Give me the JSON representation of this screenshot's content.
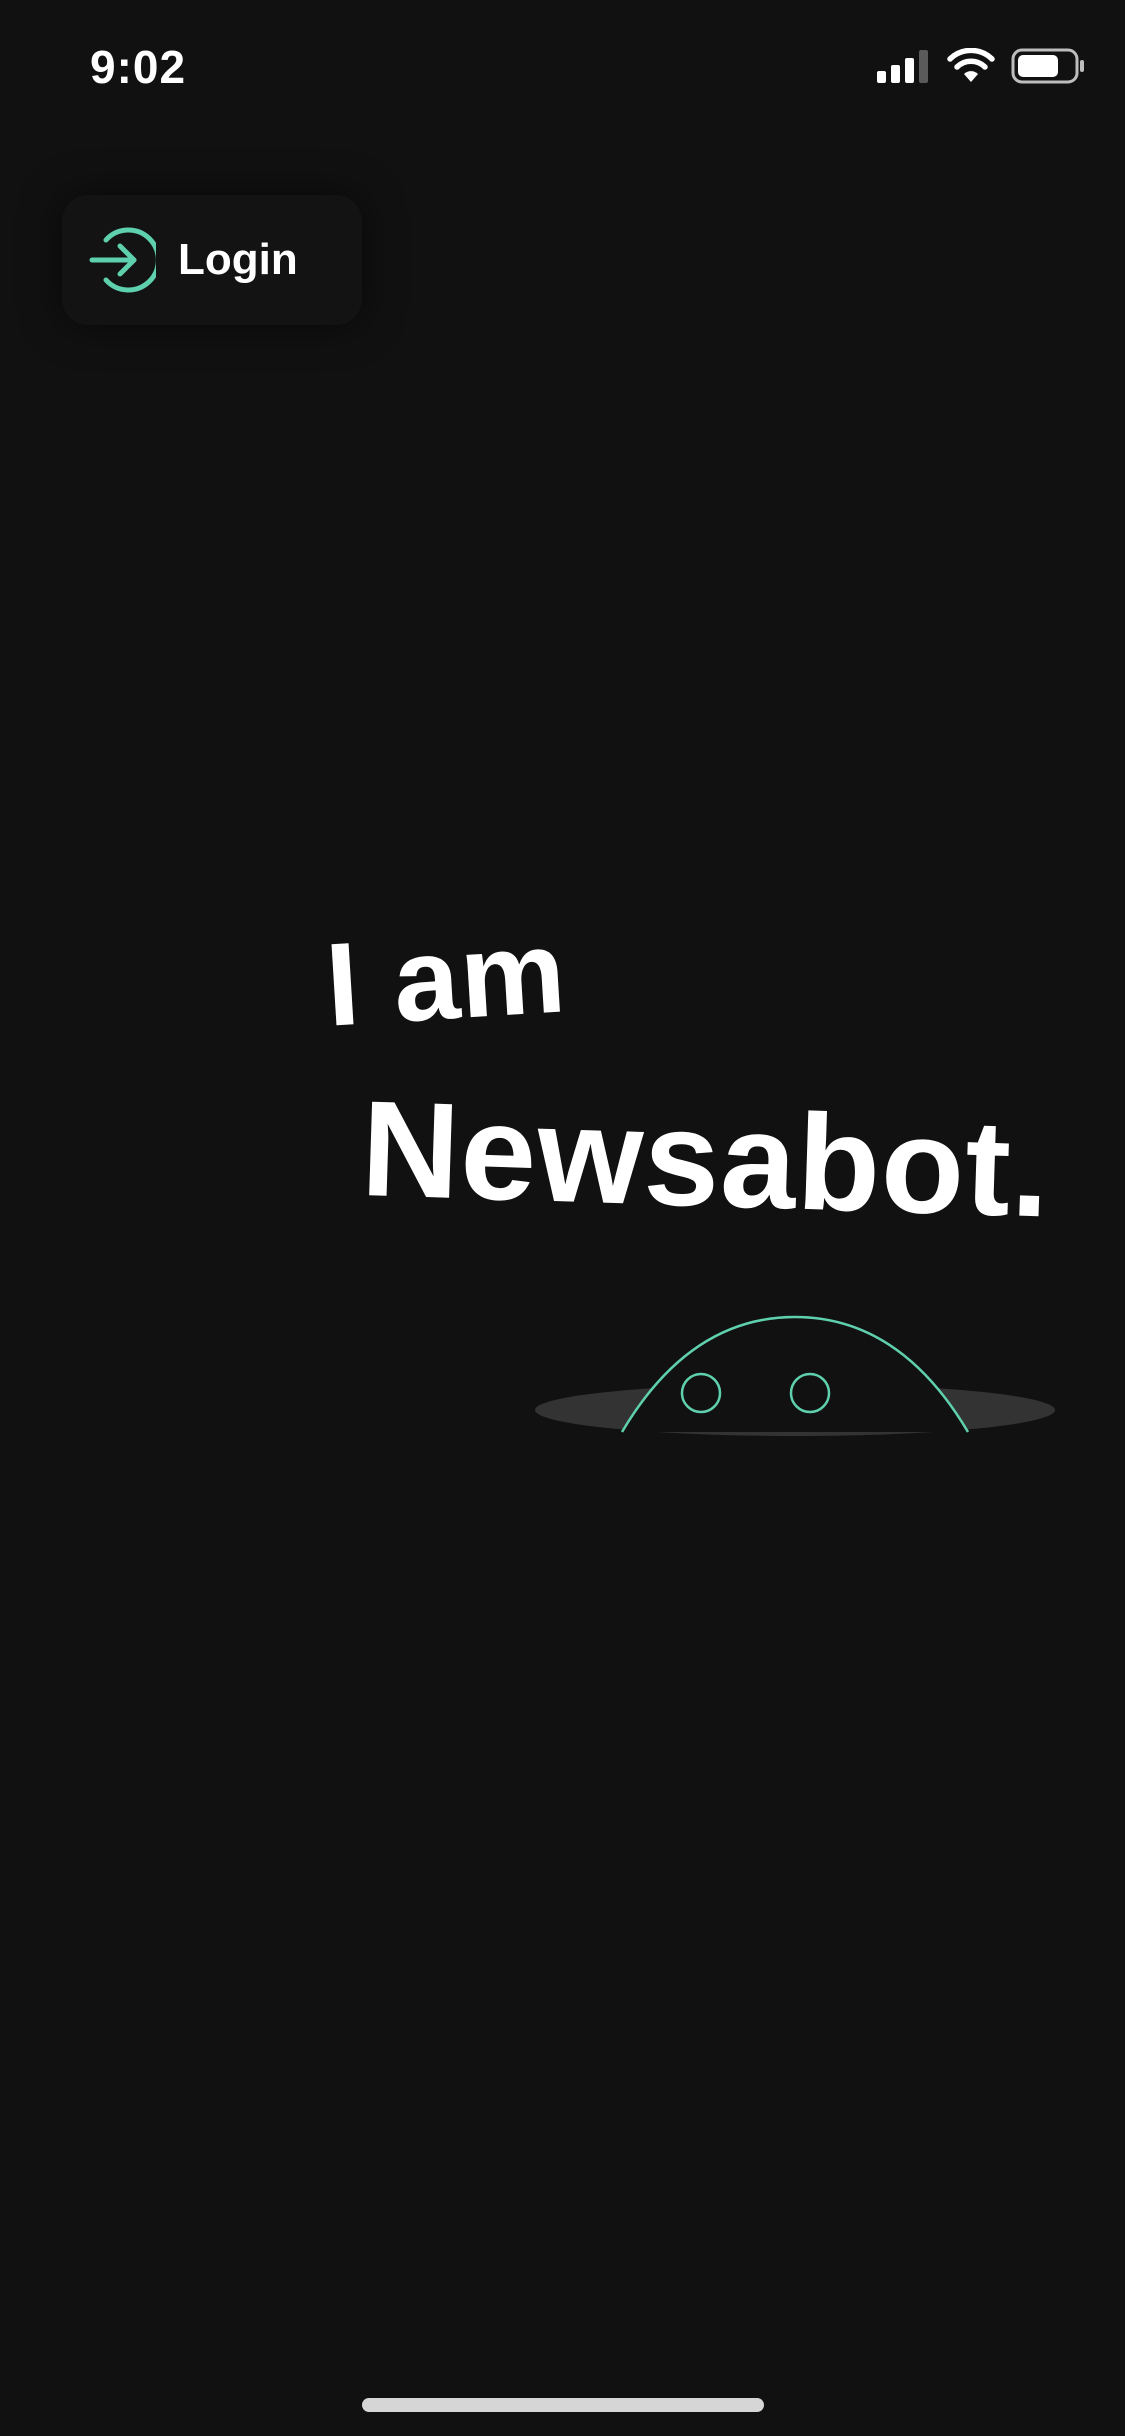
{
  "status_bar": {
    "time": "9:02",
    "signal_icon": "cellular-signal-icon",
    "wifi_icon": "wifi-icon",
    "battery_icon": "battery-icon"
  },
  "login": {
    "label": "Login",
    "icon": "login-arrow-icon"
  },
  "headline": {
    "line1": "I am",
    "line2": "Newsabot."
  },
  "illustration": {
    "icon": "robot-peeking-icon"
  },
  "colors": {
    "background": "#111111",
    "accent": "#5fd0ad",
    "text": "#ffffff"
  }
}
